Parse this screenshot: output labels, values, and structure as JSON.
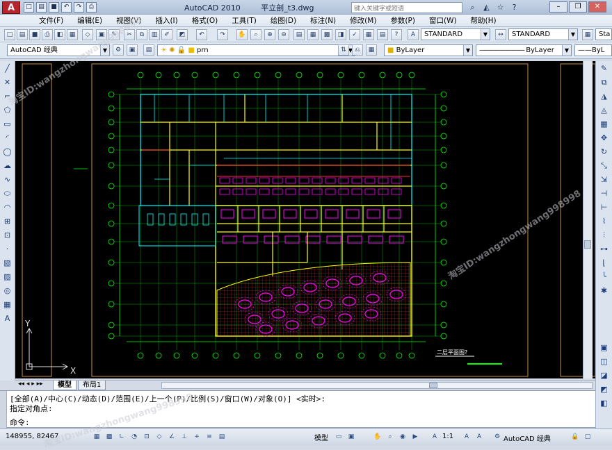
{
  "titlebar": {
    "logo": "A",
    "app_name": "AutoCAD 2010",
    "file_name": "平立剖_t3.dwg",
    "search_placeholder": "键入关键字或短语"
  },
  "menu": [
    "文件(F)",
    "编辑(E)",
    "视图(V)",
    "插入(I)",
    "格式(O)",
    "工具(T)",
    "绘图(D)",
    "标注(N)",
    "修改(M)",
    "参数(P)",
    "窗口(W)",
    "帮助(H)"
  ],
  "toolbar": {
    "text_style": "STANDARD",
    "dim_style": "STANDARD",
    "table_style": "Sta",
    "workspace": "AutoCAD 经典",
    "layer": "prn",
    "color": "ByLayer",
    "linetype": "ByLayer",
    "lineweight": "ByL"
  },
  "drawing": {
    "ucs_y": "Y",
    "ucs_x": "X",
    "plan_title": "二层平面图",
    "plan_title_marker": "?"
  },
  "tabs": [
    "模型",
    "布局1"
  ],
  "command": {
    "line1": "[全部(A)/中心(C)/动态(D)/范围(E)/上一个(P)/比例(S)/窗口(W)/对象(O)] <实时>:",
    "line2": "指定对角点:",
    "prompt": "命令:"
  },
  "status": {
    "coords": "148955, 82467",
    "model_label": "模型",
    "scale": "1:1",
    "workspace": "AutoCAD 经典"
  },
  "watermark_text": "淘宝ID:wangzhongwang998998",
  "colors": {
    "canvas": "#000000",
    "wall": "#ffff00",
    "cyan": "#00ffff",
    "magenta": "#ff00ff",
    "grid": "#00ff00",
    "red": "#ff3030",
    "white": "#ffffff"
  }
}
